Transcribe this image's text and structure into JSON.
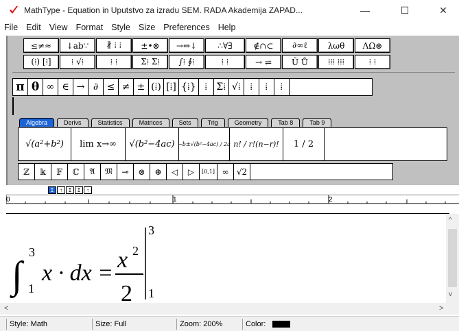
{
  "window": {
    "title": "MathType - Equation in Uputstvo za izradu SEM. RADA Akademija ZAPAD...",
    "minimize_label": "—",
    "maximize_label": "☐",
    "close_label": "✕"
  },
  "menu": [
    "File",
    "Edit",
    "View",
    "Format",
    "Style",
    "Size",
    "Preferences",
    "Help"
  ],
  "palette_row1": [
    "≤≠≈",
    "↓ab∵",
    "∦ ⁞ ⁞",
    "±•⊗",
    "→⇔↓",
    "∴∀∃",
    "∉∩⊂",
    "∂∞ℓ",
    "λωθ",
    "ΛΩ⊛"
  ],
  "palette_row2": [
    "(⁞) [⁞]",
    "⁞ √⁞",
    "⁞ ⁞",
    "Σ⁞ Σ⁞",
    "∫⁞ ∮⁞",
    "⁞ ⁞",
    "→ ⇌",
    "Ū Ů",
    "⁞⁞⁞ ⁞⁞⁞",
    "⁞ ⁞"
  ],
  "symbols": [
    "π",
    "θ",
    "∞",
    "∈",
    "→",
    "∂",
    "≤",
    "≠",
    "±",
    "(⁞)",
    "[⁞]",
    "{⁞}",
    "⁞",
    "Σ⁞",
    "√⁞",
    "⁞",
    "⁞",
    "⁞"
  ],
  "tabs": [
    "Algebra",
    "Derivs",
    "Statistics",
    "Matrices",
    "Sets",
    "Trig",
    "Geometry",
    "Tab 8",
    "Tab 9"
  ],
  "templates": [
    "√(a²+b²)",
    "lim x→∞",
    "√(b²−4ac)",
    "−b±√(b²−4ac) / 2a",
    "n! / r!(n−r)!",
    "1 / 2"
  ],
  "small_symbols": [
    "ℤ",
    "𝕜",
    "𝔽",
    "ℂ",
    "𝔄",
    "𝔐",
    "⊸",
    "⊗",
    "⊕",
    "◁",
    "▷",
    "[0,1]",
    "∞",
    "√2"
  ],
  "tabstop_buttons": [
    "↥",
    "↑",
    "↥",
    "↥",
    "↑"
  ],
  "ruler_numbers": [
    "0",
    "1",
    "2"
  ],
  "equation": {
    "integral": "∫",
    "upper": "3",
    "lower": "1",
    "body": "x · dx =",
    "numerator": "x",
    "numerator_exp": "2",
    "denominator": "2",
    "eval_upper": "3",
    "eval_lower": "1"
  },
  "scroll": {
    "up": "^",
    "down": "v",
    "left": "<",
    "right": ">"
  },
  "status": {
    "style": "Style: Math",
    "size": "Size: Full",
    "zoom": "Zoom: 200%",
    "color": "Color:"
  }
}
